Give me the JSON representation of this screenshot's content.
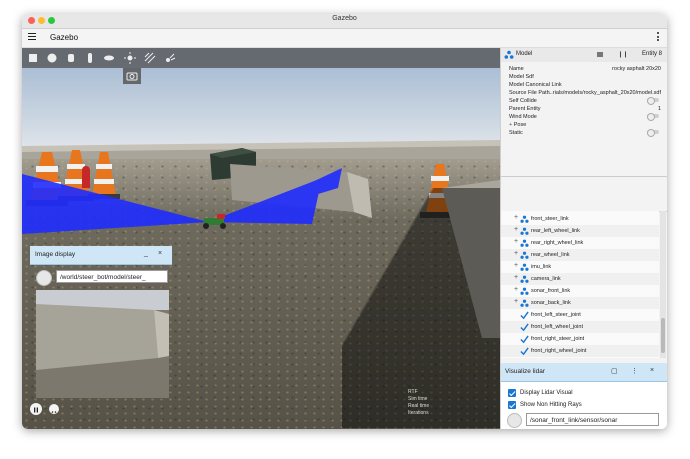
{
  "window": {
    "title": "Gazebo"
  },
  "appbar": {
    "title": "Gazebo"
  },
  "image_display": {
    "title": "Image display",
    "topic": "/world/steer_bot/model/steer_",
    "minimize": "_",
    "close": "×"
  },
  "component_inspector": {
    "title": "Model",
    "entity": "Entity 8",
    "properties": [
      {
        "name": "Name",
        "value": "rocky asphalt 20x20"
      },
      {
        "name": "Model Sdf",
        "value": ""
      },
      {
        "name": "Model Canonical Link",
        "value": ""
      },
      {
        "name": "Source File Path",
        "value": "...rials/models/rocky_asphalt_20x20/model.sdf"
      },
      {
        "name": "Self Collide",
        "value": ""
      },
      {
        "name": "Parent Entity",
        "value": "1"
      },
      {
        "name": "Wind Mode",
        "value": ""
      },
      {
        "name": "Pose",
        "value": ""
      },
      {
        "name": "Static",
        "value": ""
      }
    ]
  },
  "entity_tree": {
    "items": [
      {
        "label": "front_steer_link",
        "kind": "link"
      },
      {
        "label": "rear_left_wheel_link",
        "kind": "link"
      },
      {
        "label": "rear_right_wheel_link",
        "kind": "link"
      },
      {
        "label": "rear_wheel_link",
        "kind": "link"
      },
      {
        "label": "imu_link",
        "kind": "link"
      },
      {
        "label": "camera_link",
        "kind": "link"
      },
      {
        "label": "sonar_front_link",
        "kind": "link"
      },
      {
        "label": "sonar_back_link",
        "kind": "link"
      },
      {
        "label": "front_left_steer_joint",
        "kind": "joint"
      },
      {
        "label": "front_left_wheel_joint",
        "kind": "joint"
      },
      {
        "label": "front_right_steer_joint",
        "kind": "joint"
      },
      {
        "label": "front_right_wheel_joint",
        "kind": "joint"
      }
    ]
  },
  "visualize_lidar": {
    "title": "Visualize lidar",
    "display_lidar_visual": "Display Lidar Visual",
    "show_non_hitting_rays": "Show Non Hitting Rays",
    "topic": "/sonar_front_link/sensor/sonar"
  },
  "stats": {
    "rtf_label": "RTF",
    "sim_time_label": "Sim time",
    "real_time_label": "Real time",
    "iterations_label": "Iterations"
  },
  "colors": {
    "accent": "#1976d2",
    "panel_header": "#cfe6f7",
    "lidar_rays": "#1f2cff",
    "cone_orange": "#e8761e"
  }
}
